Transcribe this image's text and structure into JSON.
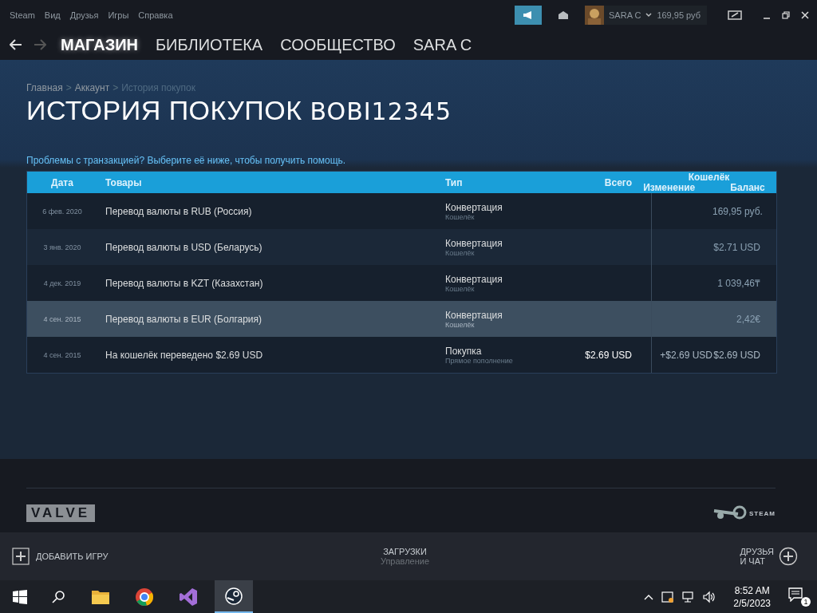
{
  "menu": [
    "Steam",
    "Вид",
    "Друзья",
    "Игры",
    "Справка"
  ],
  "account": {
    "name": "SARA C",
    "balance": "169,95 руб"
  },
  "nav": [
    {
      "label": "МАГАЗИН",
      "selected": true
    },
    {
      "label": "БИБЛИОТЕКА",
      "selected": false
    },
    {
      "label": "СООБЩЕСТВО",
      "selected": false
    },
    {
      "label": "SARA C",
      "selected": false
    }
  ],
  "breadcrumbs": [
    {
      "label": "Главная",
      "current": false
    },
    {
      "label": "Аккаунт",
      "current": false
    },
    {
      "label": "История покупок",
      "current": true
    }
  ],
  "breadcrumb_separator": ">",
  "title": "ИСТОРИЯ ПОКУПОК",
  "username": "BOBI12345",
  "help_link": "Проблемы с транзакцией? Выберите её ниже, чтобы получить помощь.",
  "table": {
    "columns": {
      "date": "Дата",
      "items": "Товары",
      "type": "Тип",
      "total": "Всего",
      "wallet": "Кошелёк",
      "change": "Изменение",
      "balance": "Баланс"
    },
    "rows": [
      {
        "date": "6 фев. 2020",
        "item": "Перевод валюты в RUB (Россия)",
        "type": "Конвертация",
        "subtype": "Кошелёк",
        "balance": "169,95 руб.",
        "selected": false
      },
      {
        "date": "3 янв. 2020",
        "item": "Перевод валюты в USD (Беларусь)",
        "type": "Конвертация",
        "subtype": "Кошелёк",
        "balance": "$2.71 USD",
        "selected": false
      },
      {
        "date": "4 дек. 2019",
        "item": "Перевод валюты в KZT (Казахстан)",
        "type": "Конвертация",
        "subtype": "Кошелёк",
        "balance": "1 039,46₸",
        "selected": false
      },
      {
        "date": "4 сен. 2015",
        "item": "Перевод валюты в EUR (Болгария)",
        "type": "Конвертация",
        "subtype": "Кошелёк",
        "balance": "2,42€",
        "selected": true
      },
      {
        "date": "4 сен. 2015",
        "item": "На кошелёк переведено $2.69 USD",
        "type": "Покупка",
        "subtype": "Прямое пополнение",
        "total": "$2.69 USD",
        "change": "+$2.69 USD",
        "balance": "$2.69 USD",
        "selected": false
      }
    ]
  },
  "footer": {
    "valve": "VALVE",
    "steam": "STEAM"
  },
  "bottom_bar": {
    "add_game": "ДОБАВИТЬ ИГРУ",
    "downloads": "ЗАГРУЗКИ",
    "downloads_sub": "Управление",
    "friends": "ДРУЗЬЯ\nИ ЧАТ"
  },
  "taskbar": {
    "time": "8:52 AM",
    "date": "2/5/2023",
    "notifications": "1"
  }
}
